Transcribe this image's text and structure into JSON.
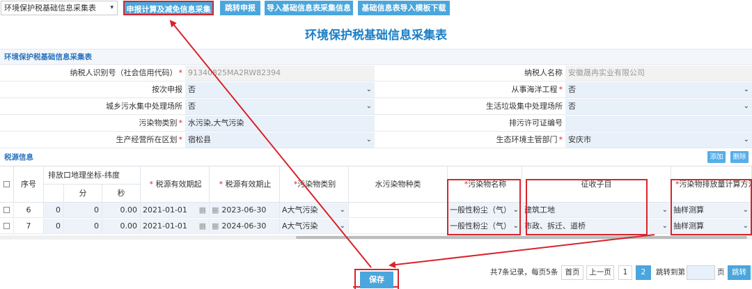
{
  "toolbar": {
    "select_value": "环境保护税基础信息采集表",
    "btn_calc": "申报计算及减免信息采集",
    "btn_jump": "跳转申报",
    "btn_import": "导入基础信息表采集信息",
    "btn_template": "基础信息表导入模板下载"
  },
  "page_title": "环境保护税基础信息采集表",
  "basic_section": {
    "title": "环境保护税基础信息采集表",
    "taxpayer_id_label": "纳税人识别号（社会信用代码）",
    "taxpayer_id_value": "91340825MA2RW82394",
    "taxpayer_name_label": "纳税人名称",
    "taxpayer_name_value": "安徽晟冉实业有限公司",
    "by_times_label": "按次申报",
    "by_times_value": "否",
    "ocean_label": "从事海洋工程",
    "ocean_value": "否",
    "sewage_label": "城乡污水集中处理场所",
    "sewage_value": "否",
    "garbage_label": "生活垃圾集中处理场所",
    "garbage_value": "否",
    "pollutant_type_label": "污染物类别",
    "pollutant_type_value": "水污染,大气污染",
    "permit_label": "排污许可证编号",
    "permit_value": "",
    "district_label": "生产经营所在区划",
    "district_value": "宿松县",
    "dept_label": "生态环境主管部门",
    "dept_value": "安庆市"
  },
  "source_section": {
    "title": "税源信息",
    "add_btn": "添加",
    "delete_btn": "删除",
    "headers": {
      "seq": "序号",
      "lat_group": "排放口地理坐标-纬度",
      "minute": "分",
      "second": "秒",
      "start": "税源有效期起",
      "end": "税源有效期止",
      "pollutant_category": "污染物类别",
      "water_kind": "水污染物种类",
      "pollutant_name": "污染物名称",
      "sub_item": "征收子目",
      "calc_method": "污染物排放量计算方法"
    },
    "rows": [
      {
        "seq": "6",
        "deg": "0",
        "min": "0",
        "sec": "0.00",
        "start": "2021-01-01",
        "end": "2023-06-30",
        "category": "A大气污染",
        "water": "",
        "name": "一般性粉尘（气）",
        "sub": "建筑工地",
        "method": "抽样测算"
      },
      {
        "seq": "7",
        "deg": "0",
        "min": "0",
        "sec": "0.00",
        "start": "2021-01-01",
        "end": "2024-06-30",
        "category": "A大气污染",
        "water": "",
        "name": "一般性粉尘（气）",
        "sub": "市政、拆迁、道桥",
        "method": "抽样测算"
      }
    ]
  },
  "pagination": {
    "summary": "共7条记录，每页5条",
    "first": "首页",
    "prev": "上一页",
    "page1": "1",
    "page2": "2",
    "jump_label": "跳转到第",
    "page_unit": "页",
    "jump_btn": "跳转"
  },
  "save_btn": "保存",
  "colors": {
    "accent": "#4aa6dc",
    "highlight": "#d8232a",
    "title": "#1b7fc7"
  }
}
